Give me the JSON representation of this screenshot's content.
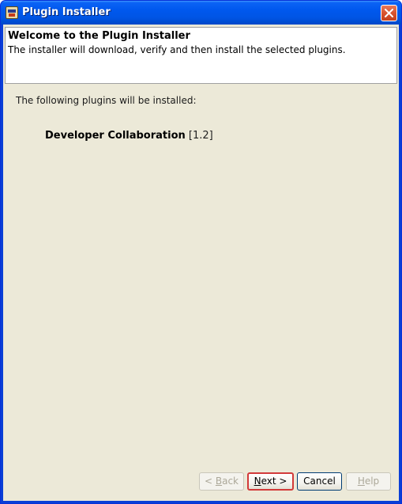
{
  "window": {
    "title": "Plugin Installer",
    "close_icon": "close-icon",
    "app_icon": "plugin-installer-icon"
  },
  "header": {
    "title": "Welcome to the Plugin Installer",
    "description": "The installer will download, verify and then install the selected plugins."
  },
  "content": {
    "intro": "The following plugins will be installed:",
    "plugins": [
      {
        "name": "Developer Collaboration",
        "version": "[1.2]"
      }
    ]
  },
  "buttons": {
    "back": {
      "prefix": "< ",
      "mnemonic": "B",
      "rest": "ack",
      "enabled": false
    },
    "next": {
      "prefix": "",
      "mnemonic": "N",
      "rest": "ext >",
      "enabled": true
    },
    "cancel": {
      "label": "Cancel",
      "enabled": true
    },
    "help": {
      "prefix": "",
      "mnemonic": "H",
      "rest": "elp",
      "enabled": false
    }
  },
  "colors": {
    "titlebar": "#0058ee",
    "close_button": "#d8532e",
    "dialog_background": "#ece9d8",
    "focus_highlight": "#d23a3a"
  }
}
